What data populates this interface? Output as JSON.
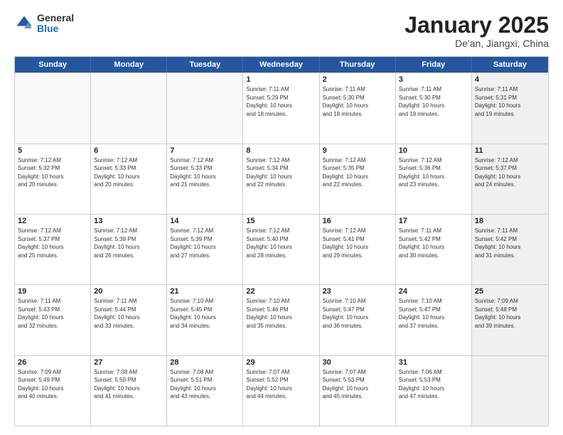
{
  "header": {
    "logo": {
      "general": "General",
      "blue": "Blue"
    },
    "title": "January 2025",
    "subtitle": "De'an, Jiangxi, China"
  },
  "calendar": {
    "days_of_week": [
      "Sunday",
      "Monday",
      "Tuesday",
      "Wednesday",
      "Thursday",
      "Friday",
      "Saturday"
    ],
    "weeks": [
      [
        {
          "day": "",
          "info": "",
          "empty": true
        },
        {
          "day": "",
          "info": "",
          "empty": true
        },
        {
          "day": "",
          "info": "",
          "empty": true
        },
        {
          "day": "1",
          "info": "Sunrise: 7:11 AM\nSunset: 5:29 PM\nDaylight: 10 hours\nand 18 minutes."
        },
        {
          "day": "2",
          "info": "Sunrise: 7:11 AM\nSunset: 5:30 PM\nDaylight: 10 hours\nand 18 minutes."
        },
        {
          "day": "3",
          "info": "Sunrise: 7:11 AM\nSunset: 5:30 PM\nDaylight: 10 hours\nand 19 minutes."
        },
        {
          "day": "4",
          "info": "Sunrise: 7:11 AM\nSunset: 5:31 PM\nDaylight: 10 hours\nand 19 minutes.",
          "shaded": true
        }
      ],
      [
        {
          "day": "5",
          "info": "Sunrise: 7:12 AM\nSunset: 5:32 PM\nDaylight: 10 hours\nand 20 minutes."
        },
        {
          "day": "6",
          "info": "Sunrise: 7:12 AM\nSunset: 5:33 PM\nDaylight: 10 hours\nand 20 minutes."
        },
        {
          "day": "7",
          "info": "Sunrise: 7:12 AM\nSunset: 5:33 PM\nDaylight: 10 hours\nand 21 minutes."
        },
        {
          "day": "8",
          "info": "Sunrise: 7:12 AM\nSunset: 5:34 PM\nDaylight: 10 hours\nand 22 minutes."
        },
        {
          "day": "9",
          "info": "Sunrise: 7:12 AM\nSunset: 5:35 PM\nDaylight: 10 hours\nand 22 minutes."
        },
        {
          "day": "10",
          "info": "Sunrise: 7:12 AM\nSunset: 5:36 PM\nDaylight: 10 hours\nand 23 minutes."
        },
        {
          "day": "11",
          "info": "Sunrise: 7:12 AM\nSunset: 5:37 PM\nDaylight: 10 hours\nand 24 minutes.",
          "shaded": true
        }
      ],
      [
        {
          "day": "12",
          "info": "Sunrise: 7:12 AM\nSunset: 5:37 PM\nDaylight: 10 hours\nand 25 minutes."
        },
        {
          "day": "13",
          "info": "Sunrise: 7:12 AM\nSunset: 5:38 PM\nDaylight: 10 hours\nand 26 minutes."
        },
        {
          "day": "14",
          "info": "Sunrise: 7:12 AM\nSunset: 5:39 PM\nDaylight: 10 hours\nand 27 minutes."
        },
        {
          "day": "15",
          "info": "Sunrise: 7:12 AM\nSunset: 5:40 PM\nDaylight: 10 hours\nand 28 minutes."
        },
        {
          "day": "16",
          "info": "Sunrise: 7:12 AM\nSunset: 5:41 PM\nDaylight: 10 hours\nand 29 minutes."
        },
        {
          "day": "17",
          "info": "Sunrise: 7:11 AM\nSunset: 5:42 PM\nDaylight: 10 hours\nand 30 minutes."
        },
        {
          "day": "18",
          "info": "Sunrise: 7:11 AM\nSunset: 5:42 PM\nDaylight: 10 hours\nand 31 minutes.",
          "shaded": true
        }
      ],
      [
        {
          "day": "19",
          "info": "Sunrise: 7:11 AM\nSunset: 5:43 PM\nDaylight: 10 hours\nand 32 minutes."
        },
        {
          "day": "20",
          "info": "Sunrise: 7:11 AM\nSunset: 5:44 PM\nDaylight: 10 hours\nand 33 minutes."
        },
        {
          "day": "21",
          "info": "Sunrise: 7:10 AM\nSunset: 5:45 PM\nDaylight: 10 hours\nand 34 minutes."
        },
        {
          "day": "22",
          "info": "Sunrise: 7:10 AM\nSunset: 5:46 PM\nDaylight: 10 hours\nand 35 minutes."
        },
        {
          "day": "23",
          "info": "Sunrise: 7:10 AM\nSunset: 5:47 PM\nDaylight: 10 hours\nand 36 minutes."
        },
        {
          "day": "24",
          "info": "Sunrise: 7:10 AM\nSunset: 5:47 PM\nDaylight: 10 hours\nand 37 minutes."
        },
        {
          "day": "25",
          "info": "Sunrise: 7:09 AM\nSunset: 5:48 PM\nDaylight: 10 hours\nand 39 minutes.",
          "shaded": true
        }
      ],
      [
        {
          "day": "26",
          "info": "Sunrise: 7:09 AM\nSunset: 5:49 PM\nDaylight: 10 hours\nand 40 minutes."
        },
        {
          "day": "27",
          "info": "Sunrise: 7:08 AM\nSunset: 5:50 PM\nDaylight: 10 hours\nand 41 minutes."
        },
        {
          "day": "28",
          "info": "Sunrise: 7:08 AM\nSunset: 5:51 PM\nDaylight: 10 hours\nand 43 minutes."
        },
        {
          "day": "29",
          "info": "Sunrise: 7:07 AM\nSunset: 5:52 PM\nDaylight: 10 hours\nand 44 minutes."
        },
        {
          "day": "30",
          "info": "Sunrise: 7:07 AM\nSunset: 5:53 PM\nDaylight: 10 hours\nand 45 minutes."
        },
        {
          "day": "31",
          "info": "Sunrise: 7:06 AM\nSunset: 5:53 PM\nDaylight: 10 hours\nand 47 minutes."
        },
        {
          "day": "",
          "info": "",
          "empty": true,
          "shaded": true
        }
      ]
    ]
  }
}
